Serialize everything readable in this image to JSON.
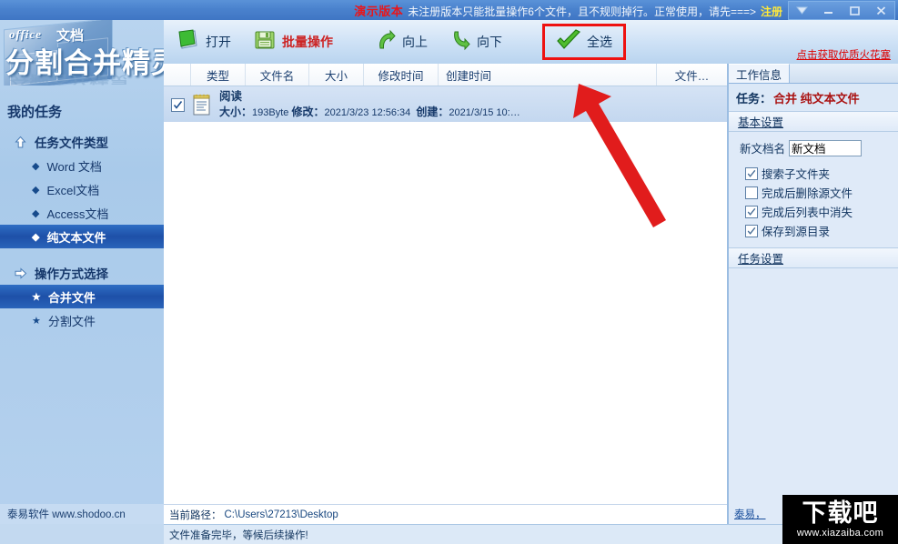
{
  "titlebar": {
    "demo_label": "演示版本",
    "notice": "未注册版本只能批量操作6个文件，且不规则掉行。正常使用，请先===>",
    "register_label": "注册",
    "controls": {
      "dropdown": "dropdown-arrow",
      "minimize": "minimize",
      "maximize": "maximize",
      "close": "close"
    }
  },
  "logo": {
    "office": "office",
    "doc": "文档",
    "main": "分割合并精灵"
  },
  "sidebar": {
    "title": "我的任务",
    "groups": [
      {
        "label": "任务文件类型",
        "icon": "up-arrow-icon",
        "items": [
          {
            "label": "Word 文档",
            "selected": false
          },
          {
            "label": "Excel文档",
            "selected": false
          },
          {
            "label": "Access文档",
            "selected": false
          },
          {
            "label": "纯文本文件",
            "selected": true
          }
        ]
      },
      {
        "label": "操作方式选择",
        "icon": "right-arrow-icon",
        "items": [
          {
            "label": "合并文件",
            "selected": true
          },
          {
            "label": "分割文件",
            "selected": false
          }
        ]
      }
    ],
    "footer": "泰易软件 www.shodoo.cn"
  },
  "toolbar": {
    "open_label": "打开",
    "batch_label": "批量操作",
    "up_label": "向上",
    "down_label": "向下",
    "selectall_label": "全选",
    "promo_link": "点击获取优质火花塞"
  },
  "filelist": {
    "columns": [
      "类型",
      "文件名",
      "大小",
      "修改时间",
      "创建时间",
      "文件…"
    ],
    "rows": [
      {
        "checked": true,
        "icon": "text-file-icon",
        "name": "阅读",
        "size_label": "大小：",
        "size_value": "193Byte",
        "modified_label": "修改：",
        "modified_value": "2021/3/23 12:56:34",
        "created_label": "创建：",
        "created_value": "2021/3/15 10:…"
      }
    ],
    "path_label": "当前路径：",
    "path_value": "C:\\Users\\27213\\Desktop"
  },
  "rightpanel": {
    "tab_label": "工作信息",
    "task_label": "任务：",
    "task_value": "合并 纯文本文件",
    "section_basic": "基本设置",
    "section_task": "任务设置",
    "newdoc_label": "新文档名",
    "newdoc_value": "新文档",
    "newdoc_placeholder": "新文档",
    "checks": [
      {
        "label": "搜索子文件夹",
        "checked": true
      },
      {
        "label": "完成后删除源文件",
        "checked": false
      },
      {
        "label": "完成后列表中消失",
        "checked": true
      },
      {
        "label": "保存到源目录",
        "checked": true
      }
    ],
    "bottom_link": "泰易，"
  },
  "statusbar": {
    "message": "文件准备完毕，等候后续操作!"
  },
  "watermark": {
    "main": "下载吧",
    "sub": "www.xiazaiba.com"
  },
  "colors": {
    "accent_blue": "#1e50a8",
    "title_blue": "#4a82cd",
    "demo_red": "#e8161b",
    "register_yellow": "#ffe93a",
    "task_red": "#aa1212",
    "highlight_red": "#ee1111",
    "arrow_red": "#e11c1c"
  }
}
